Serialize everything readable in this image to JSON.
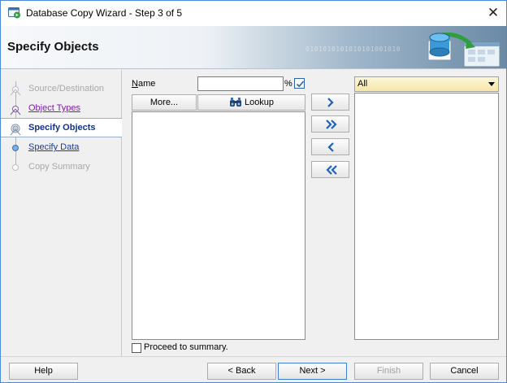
{
  "window": {
    "title": "Database Copy Wizard - Step 3 of 5",
    "close_glyph": "✕"
  },
  "header": {
    "title": "Specify Objects",
    "decor_binary": "0101010101010101001010"
  },
  "nav": {
    "items": [
      {
        "label": "Source/Destination",
        "state": "disabled"
      },
      {
        "label": "Object Types",
        "state": "visited"
      },
      {
        "label": "Specify Objects",
        "state": "active"
      },
      {
        "label": "Specify Data",
        "state": "link"
      },
      {
        "label": "Copy Summary",
        "state": "disabled"
      }
    ]
  },
  "filter": {
    "name_label": "Name",
    "name_value": "",
    "percent": "%",
    "wildcard_checked": true,
    "more_label": "More...",
    "lookup_label": "Lookup"
  },
  "shuttle": {
    "move_right": "move-selected-right",
    "move_all_right": "move-all-right",
    "move_left": "move-selected-left",
    "move_all_left": "move-all-left"
  },
  "type_select": {
    "selected": "All"
  },
  "available_items": [],
  "selected_items": [],
  "proceed": {
    "label": "Proceed to summary.",
    "checked": false
  },
  "footer": {
    "help": "Help",
    "back": "< Back",
    "next": "Next >",
    "finish": "Finish",
    "cancel": "Cancel"
  },
  "colors": {
    "accent": "#2a61b0",
    "nav_active_text": "#10328a",
    "nav_visited": "#7b1fa2",
    "disabled_text": "#a8a8a8"
  }
}
